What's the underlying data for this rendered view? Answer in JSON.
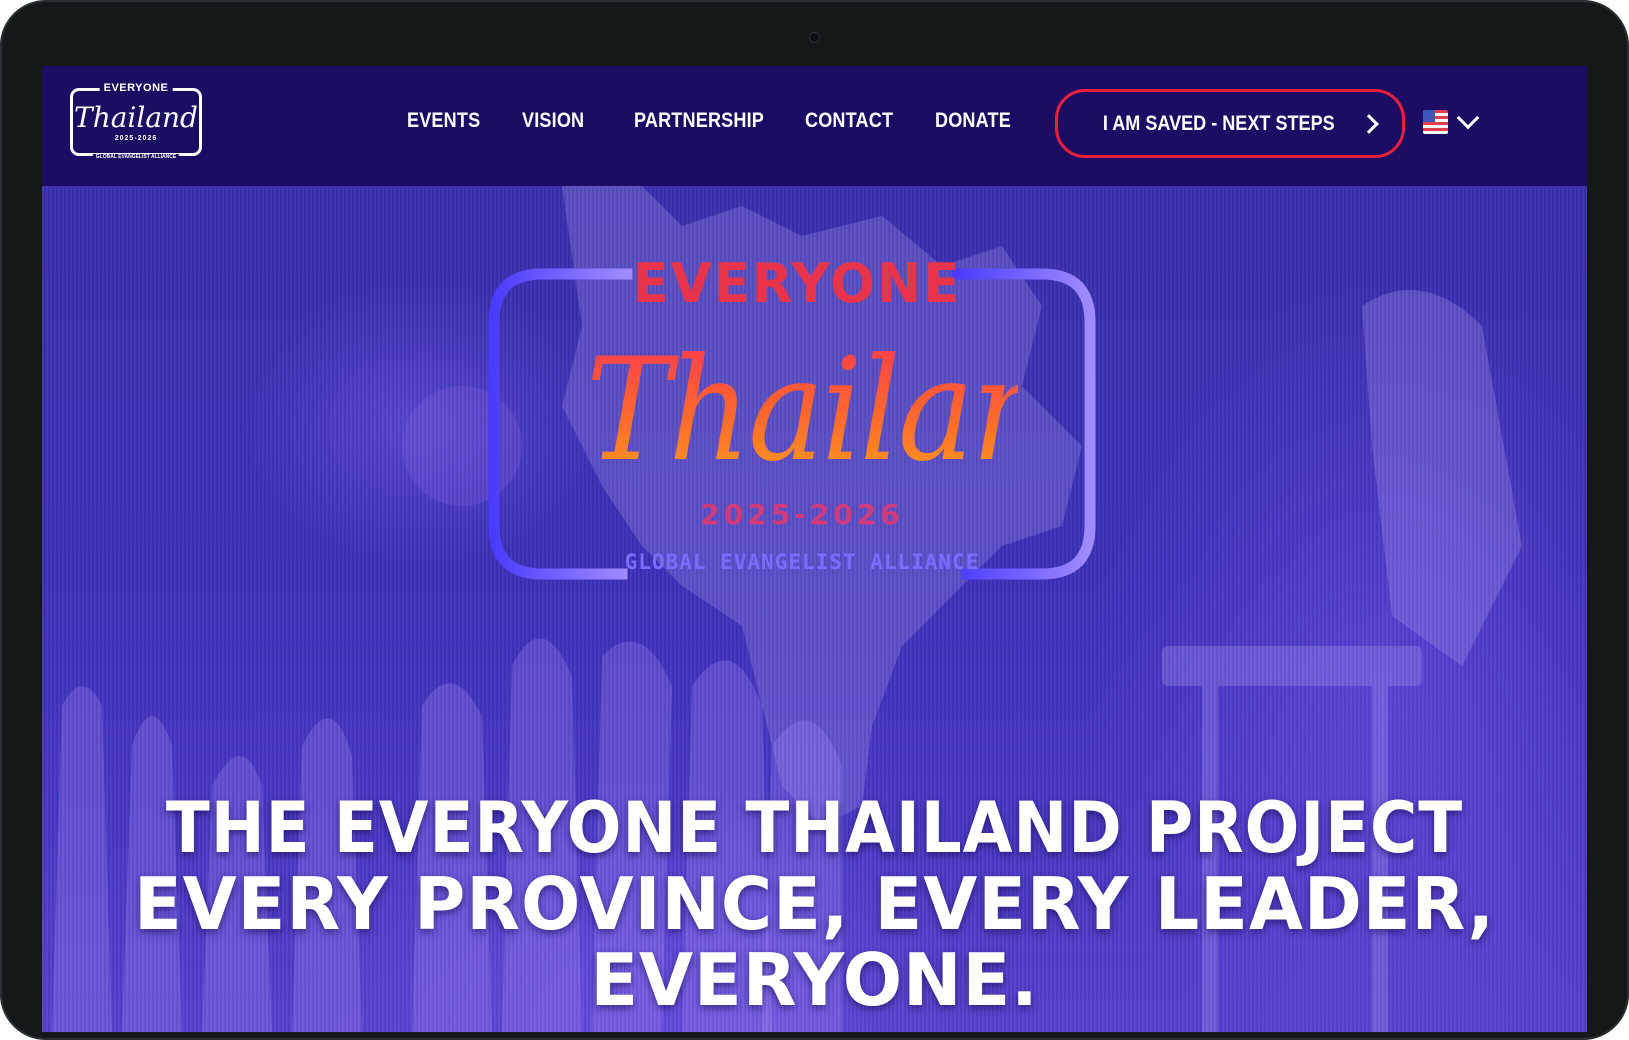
{
  "brand": {
    "logo_top": "EVERYONE",
    "logo_script": "Thailand",
    "logo_years": "2025-2026",
    "logo_bottom": "GLOBAL EVANGELIST ALLIANCE"
  },
  "nav": {
    "items": [
      {
        "label": "EVENTS"
      },
      {
        "label": "VISION"
      },
      {
        "label": "PARTNERSHIP"
      },
      {
        "label": "CONTACT"
      },
      {
        "label": "DONATE"
      }
    ],
    "cta_label": "I AM SAVED - NEXT STEPS",
    "language_flag": "us-flag-icon"
  },
  "hero": {
    "emblem_top": "EVERYONE",
    "emblem_script": "Thailand",
    "emblem_years": "2025-2026",
    "emblem_bottom": "GLOBAL EVANGELIST ALLIANCE",
    "headline_line1": "THE EVERYONE THAILAND PROJECT",
    "headline_line2": "EVERY PROVINCE, EVERY LEADER,",
    "headline_line3": "EVERYONE."
  },
  "colors": {
    "nav_bg": "#1c0c63",
    "cta_border": "#e8213a",
    "hero_purple": "#3c30b8",
    "emblem_red": "#e8344a",
    "emblem_orange": "#ff9d1f",
    "emblem_blue": "#4a3cff",
    "emblem_lavender": "#9b8aff"
  }
}
